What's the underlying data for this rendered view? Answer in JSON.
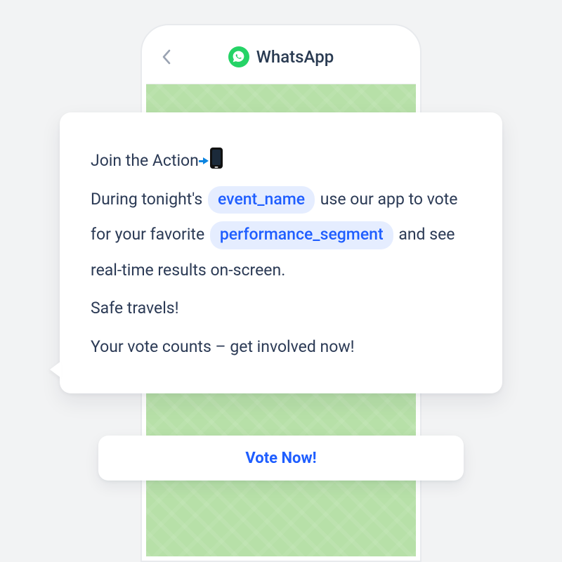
{
  "header": {
    "back_icon": "chevron-left",
    "title": "WhatsApp",
    "logo_color": "#25D366"
  },
  "message": {
    "line1_text": "Join the Action",
    "line1_icon": "phone-incoming",
    "body_pre": "During tonight's ",
    "var1": "event_name",
    "body_mid": " use our app to vote for your favorite ",
    "var2": "performance_segment",
    "body_post": " and see real-time results on-screen.",
    "line3": "Safe travels!",
    "line4": "Your vote counts – get involved now!"
  },
  "cta": {
    "label": "Vote Now!"
  },
  "colors": {
    "accent_blue": "#1f5eff",
    "chip_bg": "#e5edff",
    "text": "#2b3a55",
    "page_bg": "#f2f3f4",
    "chat_bg": "#b7e0a8"
  }
}
